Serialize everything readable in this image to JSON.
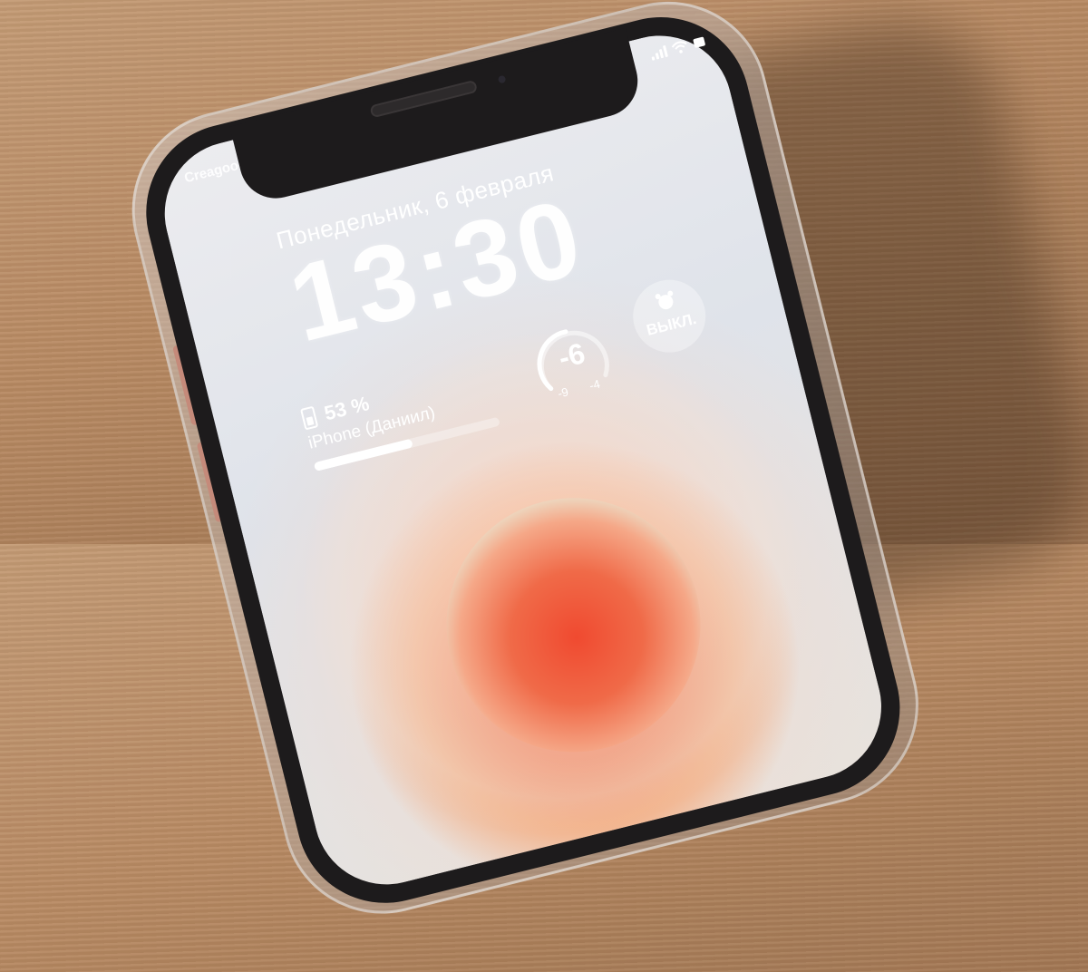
{
  "status_bar": {
    "carrier": "Creagoo",
    "icons": [
      "signal-icon",
      "wifi-icon",
      "battery-icon"
    ]
  },
  "lock_screen": {
    "date": "Понедельник, 6 февраля",
    "time": "13:30"
  },
  "widgets": {
    "battery": {
      "percent_label": "53 %",
      "level": 0.53,
      "device": "iPhone (Даниил)"
    },
    "temperature": {
      "current": "-6",
      "low": "-9",
      "high": "-4"
    },
    "alarm": {
      "icon": "alarm-clock-icon",
      "label": "ВЫКЛ."
    }
  },
  "colors": {
    "wood": "#b88a63",
    "wallpaper_accent": "#f04a30",
    "phone_frame": "#1d1b1c"
  }
}
